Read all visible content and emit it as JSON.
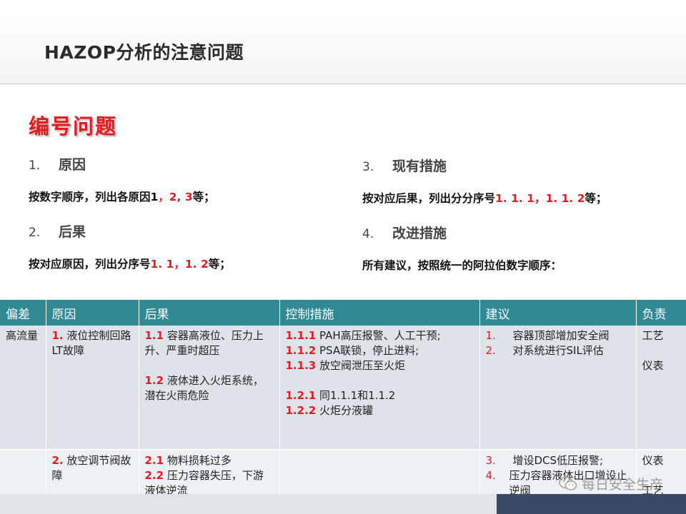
{
  "slide": {
    "title": "HAZOP分析的注意问题"
  },
  "section": {
    "heading": "编号问题"
  },
  "items": [
    {
      "num": "1.",
      "title": "原因",
      "desc_prefix": "按数字顺序，列出各原因1",
      "desc_red": "，2, 3",
      "desc_suffix": "等；"
    },
    {
      "num": "2.",
      "title": "后果",
      "desc_prefix": "按对应原因，列出分序号",
      "desc_red": "1. 1，1. 2",
      "desc_suffix": "等；"
    },
    {
      "num": "3.",
      "title": "现有措施",
      "desc_prefix": "按对应后果，列出分分序号",
      "desc_red": "1. 1. 1，1. 1. 2",
      "desc_suffix": "等；"
    },
    {
      "num": "4.",
      "title": "改进措施",
      "desc_prefix": "所有建议，按照统一的阿拉伯数字顺序：",
      "desc_red": "",
      "desc_suffix": ""
    }
  ],
  "table": {
    "headers": [
      "偏差",
      "原因",
      "后果",
      "控制措施",
      "建议",
      "负责"
    ],
    "rows": [
      {
        "deviation": "高流量",
        "cause": {
          "code": "1.",
          "text": "液位控制回路LT故障"
        },
        "consequences": [
          {
            "code": "1.1",
            "text": "容器高液位、压力上升、严重时超压"
          },
          {
            "code": "1.2",
            "text": "液体进入火炬系统，潜在火雨危险"
          }
        ],
        "controls_a": [
          {
            "code": "1.1.1",
            "text": "PAH高压报警、人工干预;"
          },
          {
            "code": "1.1.2",
            "text": "PSA联锁，停止进料;"
          },
          {
            "code": "1.1.3",
            "text": "放空阀泄压至火炬"
          }
        ],
        "controls_b": [
          {
            "code": "1.2.1",
            "text": "同1.1.1和1.1.2"
          },
          {
            "code": "1.2.2",
            "text": "火炬分液罐"
          }
        ],
        "recommendations": [
          {
            "num": "1.",
            "text": "容器顶部增加安全阀"
          },
          {
            "num": "2.",
            "text": "对系统进行SIL评估"
          }
        ],
        "responsible": [
          "工艺",
          "仪表"
        ]
      },
      {
        "deviation": "",
        "cause": {
          "code": "2.",
          "text": "放空调节阀故障"
        },
        "consequences": [
          {
            "code": "2.1",
            "text": "物料损耗过多"
          },
          {
            "code": "2.2",
            "text": "压力容器失压，下游液体逆流"
          }
        ],
        "recommendations": [
          {
            "num": "3.",
            "text": "增设DCS低压报警;"
          },
          {
            "num": "4.",
            "text": "压力容器液体出口增设止逆阀"
          }
        ],
        "responsible": [
          "仪表",
          "工艺"
        ]
      }
    ]
  },
  "watermark": {
    "text": "每日安全生产",
    "icon": "wechat-icon"
  },
  "colors": {
    "accent_red": "#e8191f",
    "header_teal": "#2f8a96",
    "footer_navy": "#3a4a66"
  }
}
